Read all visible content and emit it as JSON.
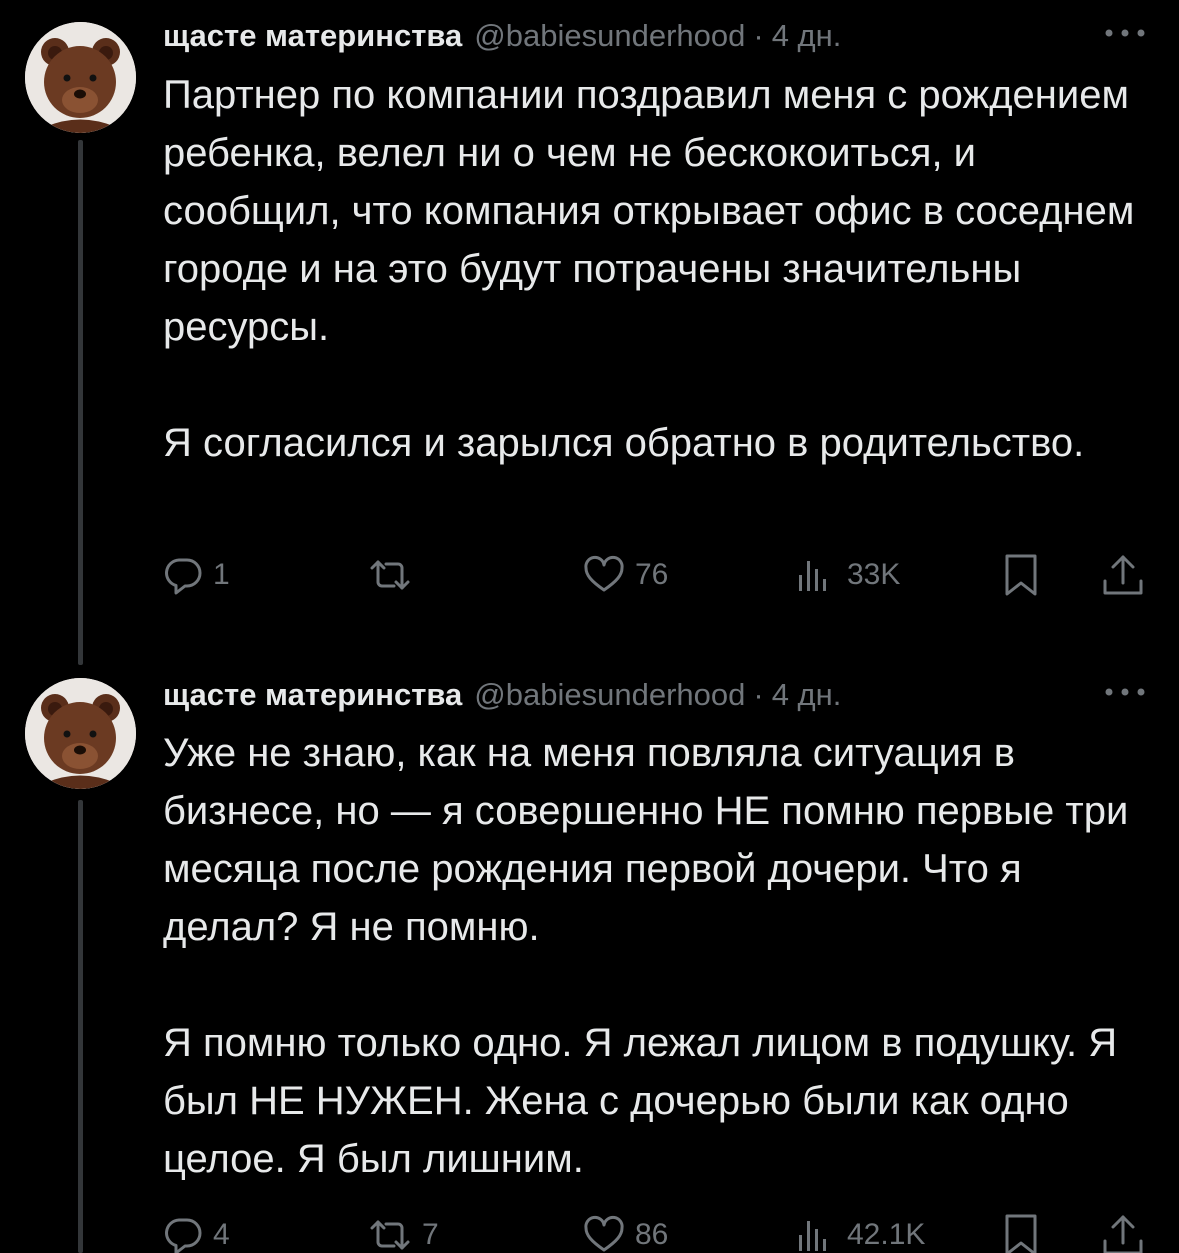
{
  "tweets": [
    {
      "display_name": "щасте материнства",
      "handle": "@babiesunderhood",
      "separator": "·",
      "time": "4 дн.",
      "paragraphs": [
        "Партнер по компании поздравил меня с рождением ребенка, велел ни о чем не бескокоиться, и сообщил, что компания открывает офис в соседнем городе и на это будут потрачены значительны ресурсы.",
        "Я согласился и зарылся обратно в родительство."
      ],
      "stats": {
        "replies": "1",
        "reposts": "",
        "likes": "76",
        "views": "33K"
      }
    },
    {
      "display_name": "щасте материнства",
      "handle": "@babiesunderhood",
      "separator": "·",
      "time": "4 дн.",
      "paragraphs": [
        "Уже не знаю, как на меня повляла ситуация в бизнесе, но — я совершенно НЕ помню первые три месяца после рождения первой дочери. Что я делал? Я не помню.",
        "Я помню только одно. Я лежал лицом в подушку. Я был НЕ НУЖЕН. Жена с дочерью были как одно целое. Я был лишним."
      ],
      "stats": {
        "replies": "4",
        "reposts": "7",
        "likes": "86",
        "views": "42.1K"
      }
    }
  ],
  "icons": {
    "reply": "reply-icon",
    "repost": "repost-icon",
    "like": "heart-icon",
    "views": "views-icon",
    "bookmark": "bookmark-icon",
    "share": "share-icon",
    "more": "more-icon",
    "avatar": "bear-avatar"
  },
  "colors": {
    "background": "#000000",
    "text": "#e7e9ea",
    "secondary": "#71767b",
    "thread_line": "#333639"
  }
}
